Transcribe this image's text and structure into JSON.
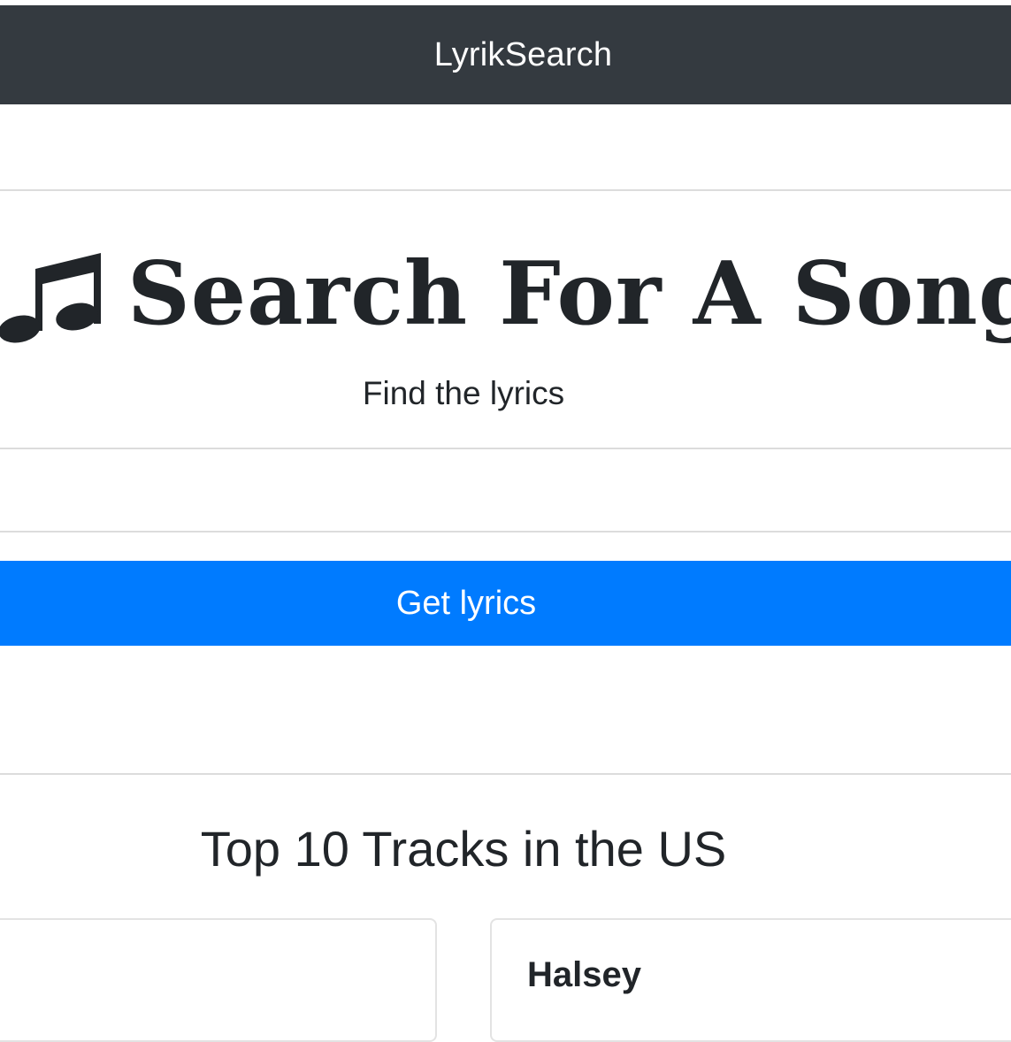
{
  "navbar": {
    "brand": "LyrikSearch"
  },
  "hero": {
    "icon": "music-note-icon",
    "title": "Search For A Song",
    "subtitle": "Find the lyrics"
  },
  "search": {
    "value": "",
    "placeholder": ""
  },
  "actions": {
    "get_lyrics_label": "Get lyrics"
  },
  "tracks_section": {
    "title": "Top 10 Tracks in the US",
    "cards": [
      {
        "artist": ""
      },
      {
        "artist": "Halsey"
      }
    ]
  },
  "colors": {
    "navbar_bg": "#343a40",
    "button_bg": "#007bff",
    "text": "#212529"
  }
}
